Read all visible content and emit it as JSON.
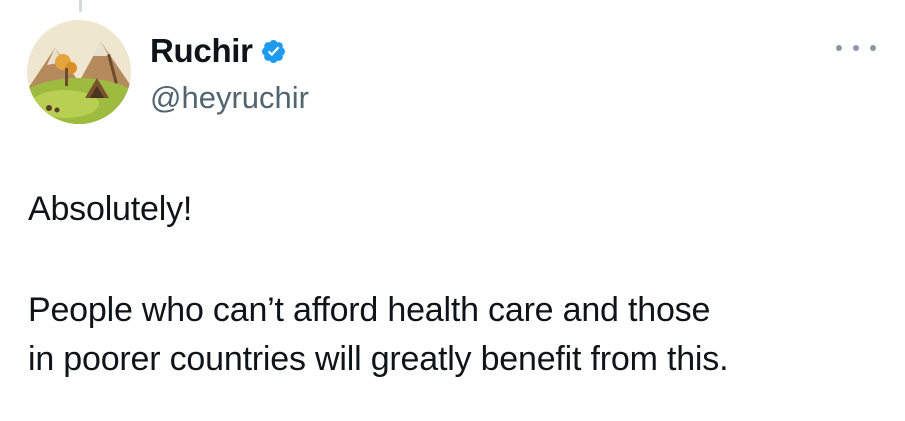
{
  "tweet": {
    "author": {
      "display_name": "Ruchir",
      "handle": "@heyruchir",
      "verified": true,
      "avatar_icon": "cartoon-landscape-avatar"
    },
    "more_icon": "more-horizontal-icon",
    "text_line_1": "Absolutely!",
    "text_line_2": "People who can’t afford health care and those\nin poorer countries will greatly benefit from this."
  },
  "colors": {
    "verified_blue": "#1d9bf0",
    "secondary_text": "#536471",
    "primary_text": "#0f1419"
  }
}
